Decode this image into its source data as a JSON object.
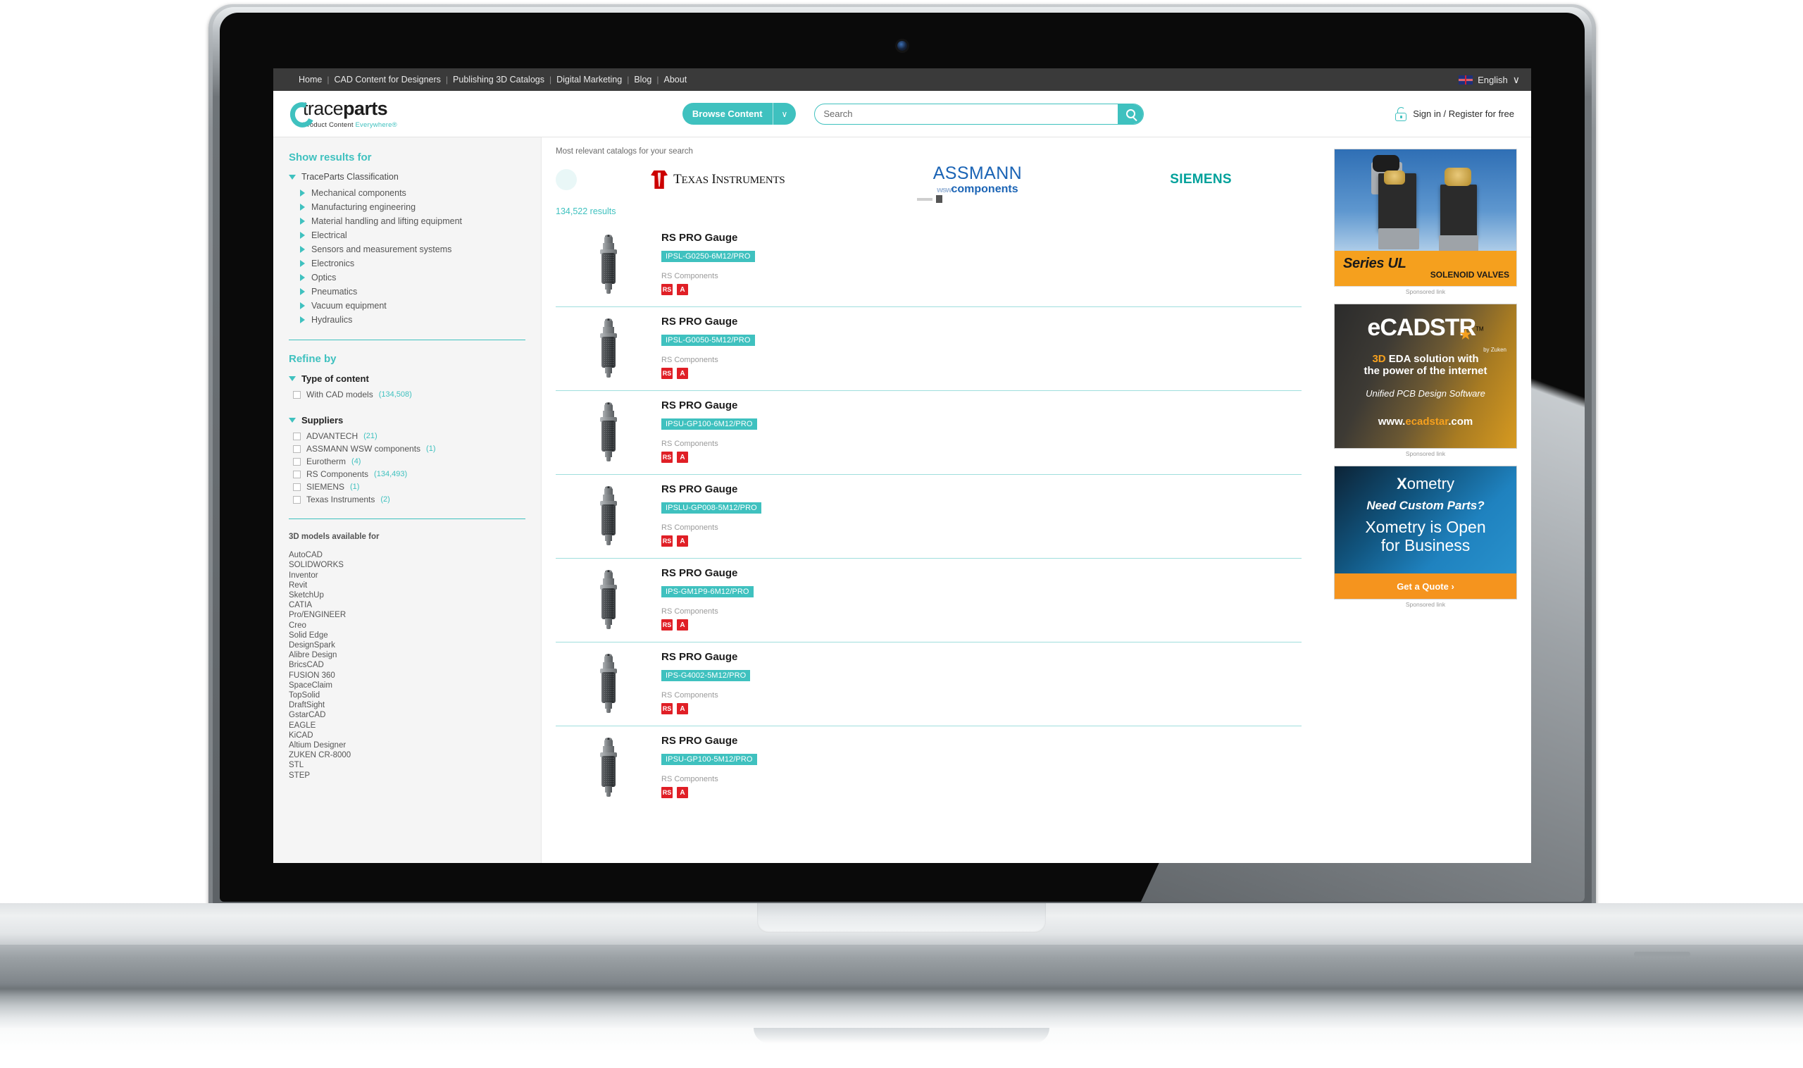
{
  "topbar": {
    "nav": [
      {
        "label": "Home"
      },
      {
        "label": "CAD Content for Designers"
      },
      {
        "label": "Publishing 3D Catalogs"
      },
      {
        "label": "Digital Marketing"
      },
      {
        "label": "Blog"
      },
      {
        "label": "About"
      }
    ],
    "separator": "|",
    "language": "English",
    "chevron": "∨"
  },
  "header": {
    "logo_trace": "trace",
    "logo_parts": "parts",
    "tagline_plain": "Product Content ",
    "tagline_accent": "Everywhere®",
    "browse_label": "Browse Content",
    "browse_arrow": "∨",
    "search_placeholder": "Search",
    "search_value": "",
    "signin_label": "Sign in / Register for free",
    "accent_color": "#3fc1bf"
  },
  "sidebar": {
    "show_results_title": "Show results for",
    "classification_root": "TraceParts Classification",
    "classification": [
      {
        "label": "Mechanical components"
      },
      {
        "label": "Manufacturing engineering"
      },
      {
        "label": "Material handling and lifting equipment"
      },
      {
        "label": "Electrical"
      },
      {
        "label": "Sensors and measurement systems"
      },
      {
        "label": "Electronics"
      },
      {
        "label": "Optics"
      },
      {
        "label": "Pneumatics"
      },
      {
        "label": "Vacuum equipment"
      },
      {
        "label": "Hydraulics"
      }
    ],
    "refine_title": "Refine by",
    "type_of_content_title": "Type of content",
    "type_of_content": [
      {
        "label": "With CAD models",
        "count": "(134,508)"
      }
    ],
    "suppliers_title": "Suppliers",
    "suppliers": [
      {
        "label": "ADVANTECH",
        "count": "(21)"
      },
      {
        "label": "ASSMANN WSW components",
        "count": "(1)"
      },
      {
        "label": "Eurotherm",
        "count": "(4)"
      },
      {
        "label": "RS Components",
        "count": "(134,493)"
      },
      {
        "label": "SIEMENS",
        "count": "(1)"
      },
      {
        "label": "Texas Instruments",
        "count": "(2)"
      }
    ],
    "cad_title": "3D models available for",
    "cad_formats": [
      "AutoCAD",
      "SOLIDWORKS",
      "Inventor",
      "Revit",
      "SketchUp",
      "CATIA",
      "Pro/ENGINEER",
      "Creo",
      "Solid Edge",
      "DesignSpark",
      "Alibre Design",
      "BricsCAD",
      "FUSION 360",
      "SpaceClaim",
      "TopSolid",
      "DraftSight",
      "GstarCAD",
      "EAGLE",
      "KiCAD",
      "Altium Designer",
      "ZUKEN CR-8000",
      "STL",
      "STEP"
    ]
  },
  "results": {
    "carousel_label": "Most relevant catalogs for your search",
    "catalogs": [
      {
        "name": "Texas Instruments"
      },
      {
        "name": "ASSMANN WSW components"
      },
      {
        "name": "SIEMENS"
      }
    ],
    "ti_text_main": "EXAS",
    "ti_text_main2": "NSTRUMENTS",
    "ti_cap_t": "T",
    "ti_cap_i": "I",
    "assmann_line1": "ASSMANN",
    "assmann_wsw": "wsw",
    "assmann_line2": "components",
    "siemens": "SIEMENS",
    "count_label": "134,522 results",
    "supplier_label": "RS Components",
    "badge_rs": "RS",
    "badge_a": "A",
    "items": [
      {
        "name": "RS PRO Gauge",
        "ref": "IPSL-G0250-6M12/PRO",
        "supplier": "RS Components"
      },
      {
        "name": "RS PRO Gauge",
        "ref": "IPSL-G0050-5M12/PRO",
        "supplier": "RS Components"
      },
      {
        "name": "RS PRO Gauge",
        "ref": "IPSU-GP100-6M12/PRO",
        "supplier": "RS Components"
      },
      {
        "name": "RS PRO Gauge",
        "ref": "IPSLU-GP008-5M12/PRO",
        "supplier": "RS Components"
      },
      {
        "name": "RS PRO Gauge",
        "ref": "IPS-GM1P9-6M12/PRO",
        "supplier": "RS Components"
      },
      {
        "name": "RS PRO Gauge",
        "ref": "IPS-G4002-5M12/PRO",
        "supplier": "RS Components"
      },
      {
        "name": "RS PRO Gauge",
        "ref": "IPSU-GP100-5M12/PRO",
        "supplier": "RS Components"
      }
    ]
  },
  "ads": {
    "sponsored_label": "Sponsored link",
    "ad1": {
      "series": "Series UL",
      "subtitle": "SOLENOID VALVES"
    },
    "ad2": {
      "logo_e": "e",
      "logo_main": "CADST",
      "logo_star": "★",
      "logo_r": "R",
      "logo_tm": "TM",
      "by": "by Zuken",
      "line1_a": "3D",
      "line1_b": " EDA solution with",
      "line2_a": "the ",
      "line2_b": "power",
      "line2_c": " of the internet",
      "line3": "Unified PCB Design Software",
      "line4_a": "www.",
      "line4_b": "ecadstar",
      "line4_c": ".com"
    },
    "ad3": {
      "brand_x": "X",
      "brand_rest": "ometry",
      "headline": "Need Custom Parts?",
      "line1": "Xometry is Open",
      "line2": "for Business",
      "cta": "Get a Quote  ›"
    }
  }
}
